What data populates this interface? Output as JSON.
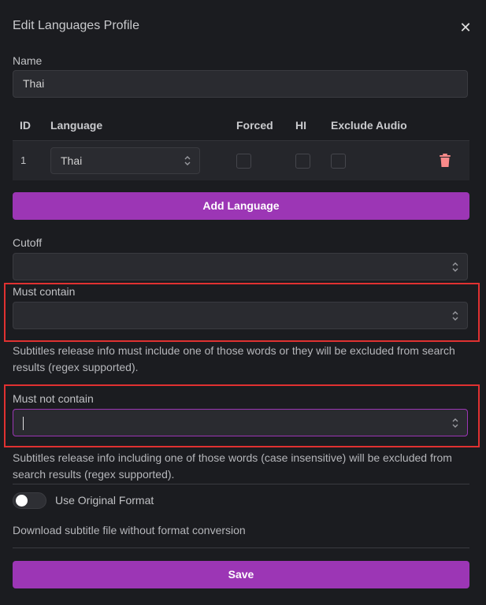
{
  "modal": {
    "title": "Edit Languages Profile",
    "close_glyph": "✕"
  },
  "name_field": {
    "label": "Name",
    "value": "Thai"
  },
  "table": {
    "headers": [
      "ID",
      "Language",
      "Forced",
      "HI",
      "Exclude Audio"
    ],
    "rows": [
      {
        "id": "1",
        "language": "Thai",
        "forced": false,
        "hi": false,
        "exclude_audio": false
      }
    ]
  },
  "add_language_label": "Add Language",
  "cutoff": {
    "label": "Cutoff",
    "value": ""
  },
  "must_contain": {
    "label": "Must contain",
    "value": "",
    "description": "Subtitles release info must include one of those words or they will be excluded from search results (regex supported)."
  },
  "must_not_contain": {
    "label": "Must not contain",
    "value": "",
    "description": "Subtitles release info including one of those words (case insensitive) will be excluded from search results (regex supported)."
  },
  "original_format": {
    "label": "Use Original Format",
    "enabled": false,
    "description": "Download subtitle file without format conversion"
  },
  "save_label": "Save",
  "colors": {
    "accent": "#9c36b5",
    "highlight": "#e03131",
    "delete": "#fa8a8a"
  }
}
